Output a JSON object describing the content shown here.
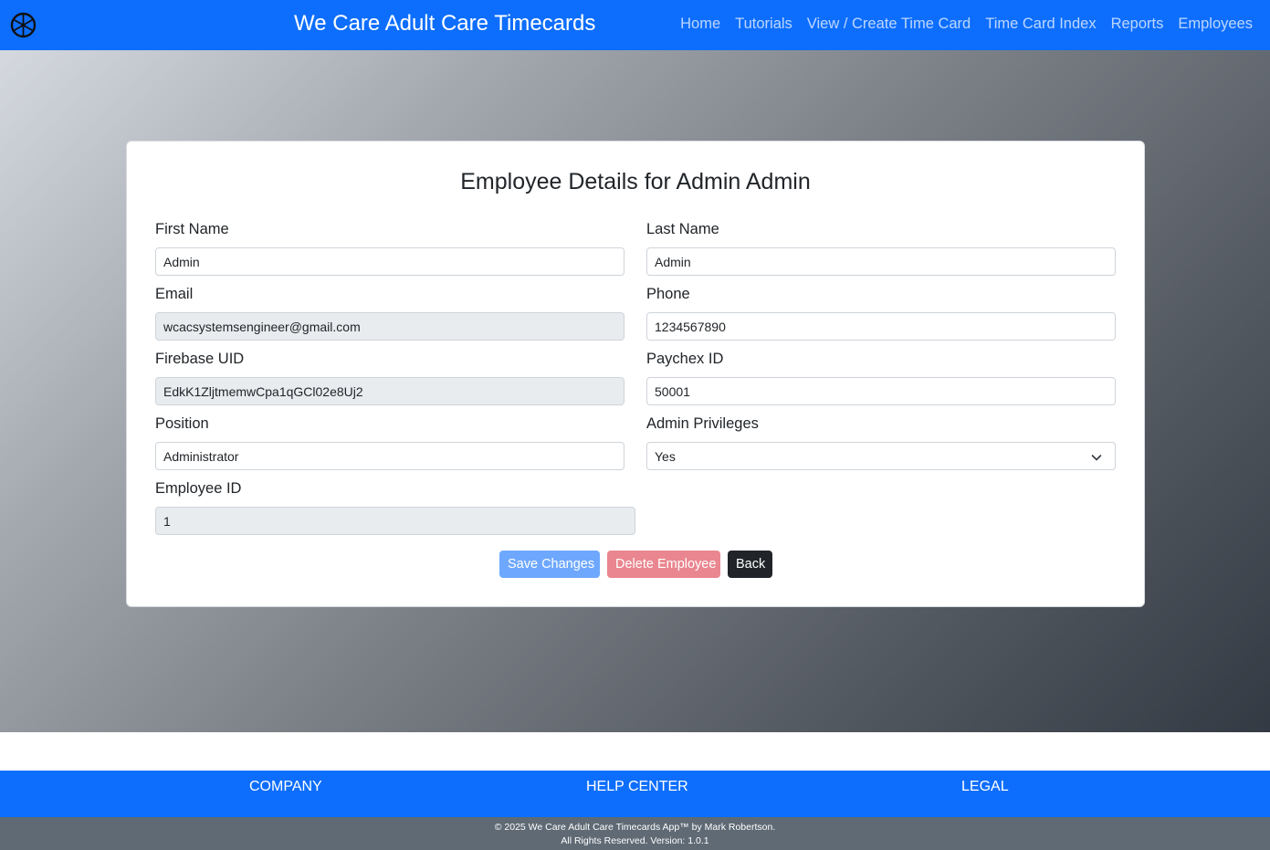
{
  "navbar": {
    "brand": "We Care Adult Care Timecards",
    "links": [
      "Home",
      "Tutorials",
      "View / Create Time Card",
      "Time Card Index",
      "Reports",
      "Employees"
    ]
  },
  "form": {
    "title": "Employee Details for Admin Admin",
    "first_name": {
      "label": "First Name",
      "value": "Admin"
    },
    "last_name": {
      "label": "Last Name",
      "value": "Admin"
    },
    "email": {
      "label": "Email",
      "value": "wcacsystemsengineer@gmail.com"
    },
    "phone": {
      "label": "Phone",
      "value": "1234567890"
    },
    "firebase_uid": {
      "label": "Firebase UID",
      "value": "EdkK1ZljtmemwCpa1qGCl02e8Uj2"
    },
    "paychex_id": {
      "label": "Paychex ID",
      "value": "50001"
    },
    "position": {
      "label": "Position",
      "value": "Administrator"
    },
    "admin_privileges": {
      "label": "Admin Privileges",
      "value": "Yes"
    },
    "employee_id": {
      "label": "Employee ID",
      "value": "1"
    }
  },
  "buttons": {
    "save": "Save Changes",
    "delete": "Delete Employee",
    "back": "Back"
  },
  "footer": {
    "company": "COMPANY",
    "help_center": "HELP CENTER",
    "legal": "LEGAL",
    "copyright_line1": "© 2025 We Care Adult Care Timecards App™ by Mark Robertson.",
    "copyright_line2": "All Rights Reserved. Version: 1.0.1"
  },
  "colors": {
    "primary": "#0d6efd",
    "save_button": "#6ea8fe",
    "delete_button": "#ea868f",
    "back_button": "#212529",
    "footer_bottom": "#5f6a75"
  }
}
